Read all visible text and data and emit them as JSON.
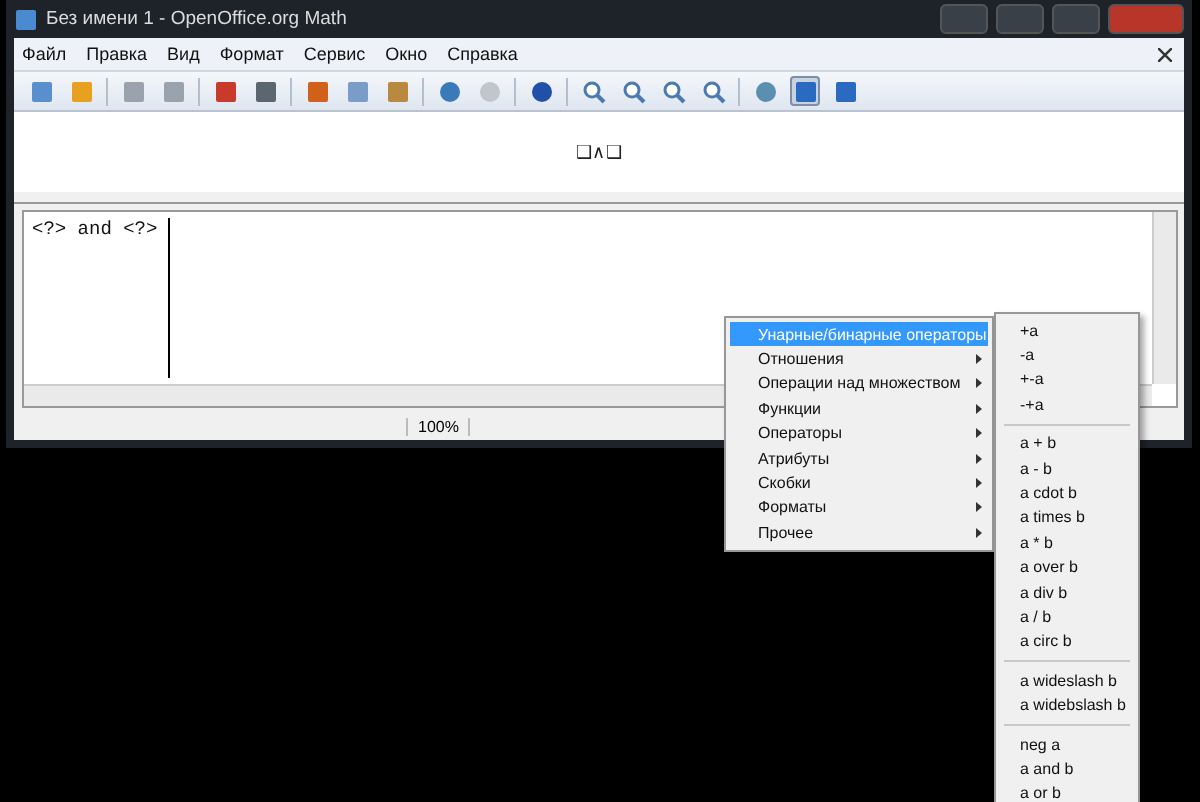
{
  "window": {
    "title": "Без имени 1 - OpenOffice.org Math"
  },
  "menu_bar": [
    "Файл",
    "Правка",
    "Вид",
    "Формат",
    "Сервис",
    "Окно",
    "Справка"
  ],
  "toolbar": {
    "formula_cursor_on": true
  },
  "preview": {
    "formula": "❑∧❑"
  },
  "editor": {
    "value": "<?> and <?> "
  },
  "status_bar": {
    "zoom": "100%"
  },
  "context_menu": [
    {
      "label": "Унарные/бинарные операторы",
      "selected": true
    },
    {
      "label": "Отношения",
      "selected": false
    },
    {
      "label": "Операции над множеством",
      "selected": false
    },
    {
      "label": "Функции",
      "selected": false
    },
    {
      "label": "Операторы",
      "selected": false
    },
    {
      "label": "Атрибуты",
      "selected": false
    },
    {
      "label": "Скобки",
      "selected": false
    },
    {
      "label": "Форматы",
      "selected": false
    },
    {
      "label": "Прочее",
      "selected": false
    }
  ],
  "submenu": [
    [
      "+a",
      "-a",
      "+-a",
      "-+a"
    ],
    [
      "a + b",
      "a - b",
      "a cdot b",
      "a times b",
      "a * b",
      "a over b",
      "a div b",
      "a / b",
      "a circ b"
    ],
    [
      "a wideslash b",
      "a widebslash b"
    ],
    [
      "neg a",
      "a and b",
      "a or b"
    ]
  ]
}
